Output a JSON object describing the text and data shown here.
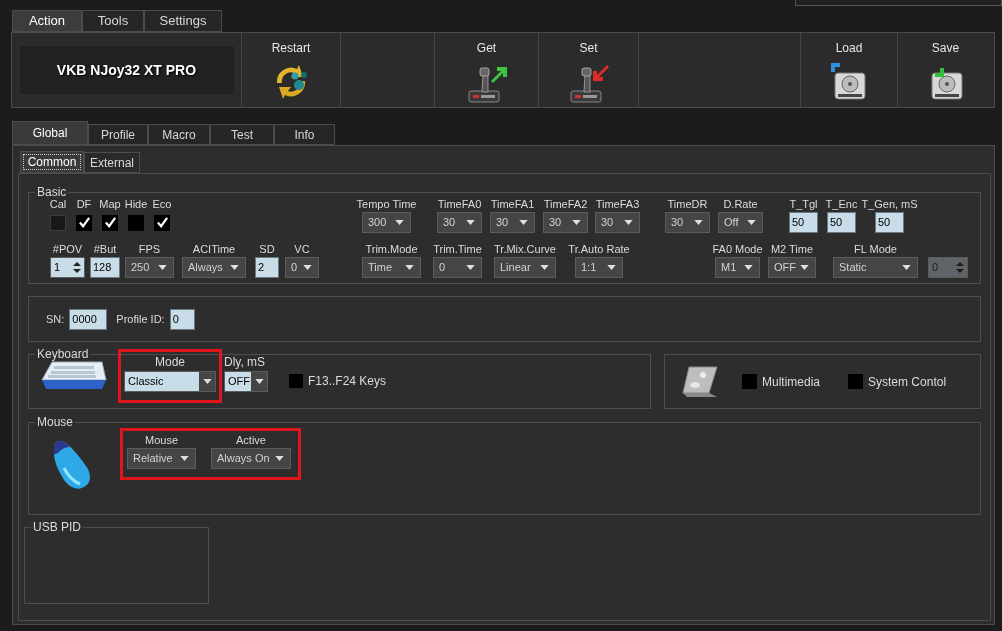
{
  "top_tabs": [
    {
      "label": "Action",
      "selected": true
    },
    {
      "label": "Tools",
      "selected": false
    },
    {
      "label": "Settings",
      "selected": false
    }
  ],
  "toolbar": {
    "device_name": "VKB NJoy32 XT PRO",
    "buttons": [
      {
        "kind": "restart",
        "label": "Restart"
      },
      {
        "kind": "get",
        "label": "Get"
      },
      {
        "kind": "set",
        "label": "Set"
      },
      {
        "kind": "load",
        "label": "Load"
      },
      {
        "kind": "save",
        "label": "Save"
      }
    ]
  },
  "tabs": [
    {
      "label": "Global",
      "selected": true
    },
    {
      "label": "Profile",
      "selected": false
    },
    {
      "label": "Macro",
      "selected": false
    },
    {
      "label": "Test",
      "selected": false
    },
    {
      "label": "Info",
      "selected": false
    }
  ],
  "subtabs": [
    {
      "label": "Common",
      "selected": true
    },
    {
      "label": "External",
      "selected": false
    }
  ],
  "basic": {
    "title": "Basic",
    "row_1": [
      {
        "kind": "checkbox",
        "label": "Cal",
        "checked": false,
        "disabled": true
      },
      {
        "kind": "checkbox",
        "label": "DF",
        "checked": true,
        "disabled": false
      },
      {
        "kind": "checkbox",
        "label": "Map",
        "checked": true,
        "disabled": false
      },
      {
        "kind": "checkbox",
        "label": "Hide",
        "checked": false,
        "disabled": false
      },
      {
        "kind": "checkbox",
        "label": "Eco",
        "checked": true,
        "disabled": false
      },
      {
        "kind": "select",
        "label": "Tempo Time",
        "value": "300"
      },
      {
        "kind": "select",
        "label": "TimeFA0",
        "value": "30"
      },
      {
        "kind": "select",
        "label": "TimeFA1",
        "value": "30"
      },
      {
        "kind": "select",
        "label": "TimeFA2",
        "value": "30"
      },
      {
        "kind": "select",
        "label": "TimeFA3",
        "value": "30"
      },
      {
        "kind": "select",
        "label": "TimeDR",
        "value": "30"
      },
      {
        "kind": "select",
        "label": "D.Rate",
        "value": "Off"
      },
      {
        "kind": "input",
        "label": "T_Tgl",
        "value": "50"
      },
      {
        "kind": "input",
        "label": "T_Enc",
        "value": "50"
      },
      {
        "kind": "input",
        "label": "T_Gen, mS",
        "value": "50"
      }
    ],
    "row_2": [
      {
        "kind": "spinner",
        "label": "#POV",
        "value": "1",
        "disabled": false
      },
      {
        "kind": "input",
        "label": "#But",
        "value": "128"
      },
      {
        "kind": "select",
        "label": "FPS",
        "value": "250"
      },
      {
        "kind": "select",
        "label": "ACITime",
        "value": "Always"
      },
      {
        "kind": "input",
        "label": "SD",
        "value": "2"
      },
      {
        "kind": "select",
        "label": "VC",
        "value": "0"
      },
      {
        "kind": "select",
        "label": "Trim.Mode",
        "value": "Time"
      },
      {
        "kind": "select",
        "label": "Trim.Time",
        "value": "0"
      },
      {
        "kind": "select",
        "label": "Tr.Mix.Curve",
        "value": "Linear"
      },
      {
        "kind": "select",
        "label": "Tr.Auto Rate",
        "value": "1:1"
      },
      {
        "kind": "select",
        "label": "FA0 Mode",
        "value": "M1"
      },
      {
        "kind": "select",
        "label": "M2 Time",
        "value": "OFF"
      },
      {
        "kind": "select",
        "label": "FL Mode",
        "value": "Static"
      },
      {
        "kind": "spinner",
        "value": "0",
        "disabled": true
      }
    ]
  },
  "ids": {
    "fields": [
      {
        "label": "SN:",
        "value": "0000"
      },
      {
        "label": "Profile ID:",
        "value": "0"
      }
    ]
  },
  "keyboard": {
    "title": "Keyboard",
    "mode": {
      "label": "Mode",
      "value": "Classic",
      "highlighted": true
    },
    "delay": {
      "label": "Dly, mS",
      "value": "OFF"
    },
    "f_keys": {
      "label": "F13..F24 Keys",
      "checked": false
    }
  },
  "extra_keys": [
    {
      "label": "Multimedia",
      "checked": false
    },
    {
      "label": "System Contol",
      "checked": false
    }
  ],
  "mouse": {
    "title": "Mouse",
    "highlighted": true,
    "fields": [
      {
        "label": "Mouse",
        "value": "Relative"
      },
      {
        "label": "Active",
        "value": "Always On"
      }
    ]
  },
  "usb_pid": {
    "title": "USB PID"
  }
}
